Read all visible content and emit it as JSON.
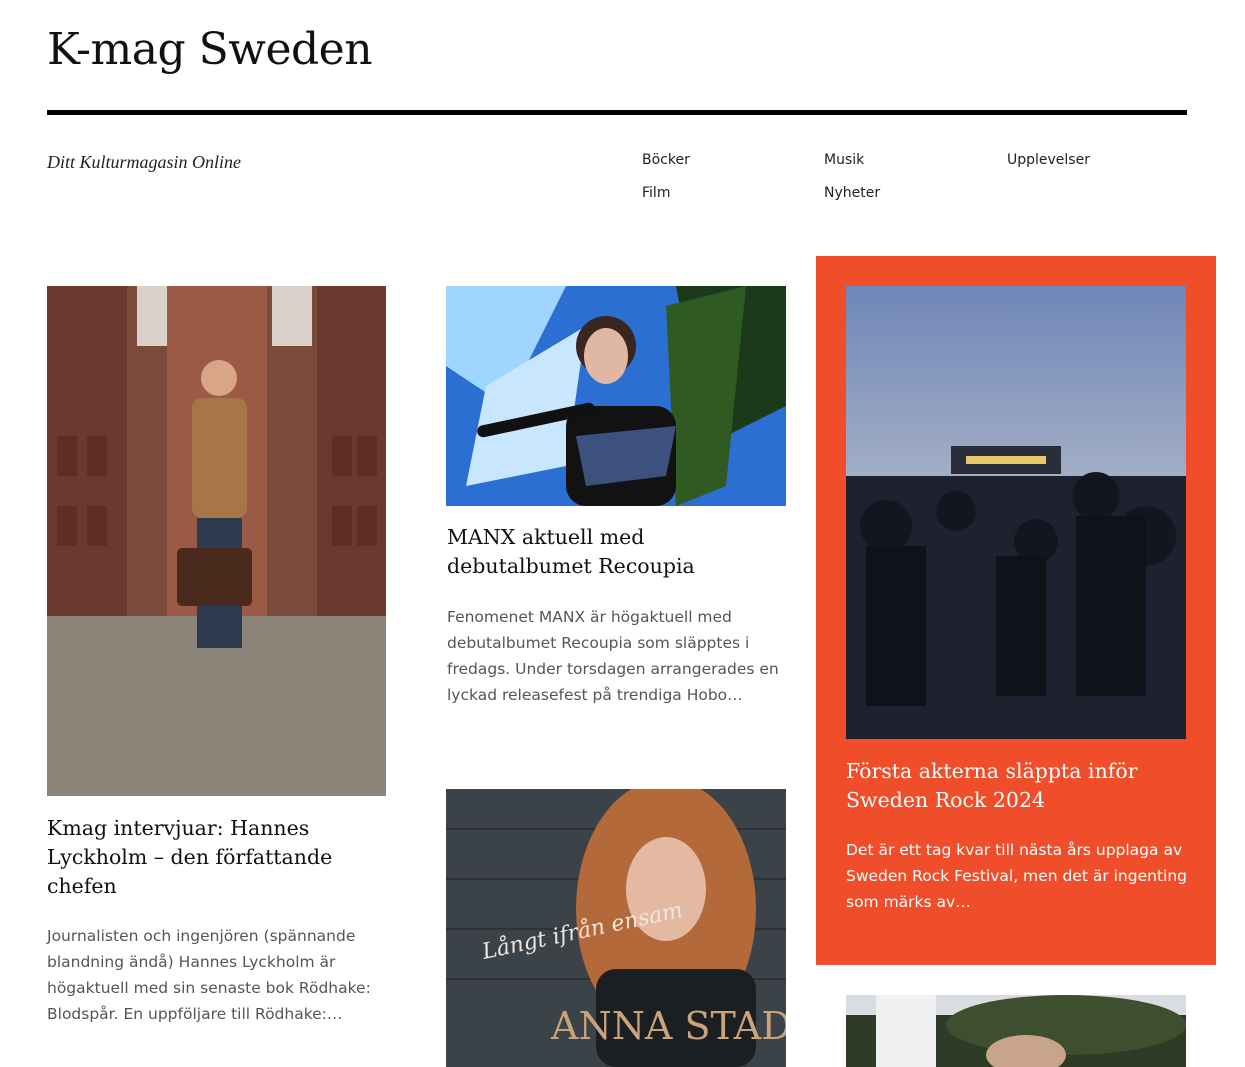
{
  "site": {
    "title": "K-mag Sweden",
    "tagline": "Ditt Kulturmagasin Online"
  },
  "menu": {
    "items": [
      {
        "label": "Böcker"
      },
      {
        "label": "Musik"
      },
      {
        "label": "Upplevelser"
      },
      {
        "label": "Film"
      },
      {
        "label": "Nyheter"
      }
    ]
  },
  "posts": [
    {
      "title": "Kmag intervjuar: Hannes Lyckholm – den författande chefen",
      "excerpt": "Journalisten och ingenjören (spännande blandning ändå) Hannes Lyckholm är högaktuell med sin senaste bok Rödhake: Blodspår. En uppföljare till Rödhake:…"
    },
    {
      "title": "MANX aktuell med debutalbumet Recoupia",
      "excerpt": "Fenomenet MANX är högaktuell med debutalbumet Recoupia som släpptes i fredags. Under torsdagen arrangerades en lyckad releasefest på trendiga Hobo…"
    },
    {
      "title": "Första akterna släppta inför Sweden Rock 2024",
      "excerpt": "Det är ett tag kvar till nästa års upplaga av Sweden Rock Festival, men det är ingenting som märks av…"
    },
    {
      "cover_script": "Långt ifrån ensam",
      "cover_name": "ANNA STADLING"
    }
  ],
  "colors": {
    "accent": "#f04e2b",
    "text": "#111111",
    "muted": "#555555"
  }
}
